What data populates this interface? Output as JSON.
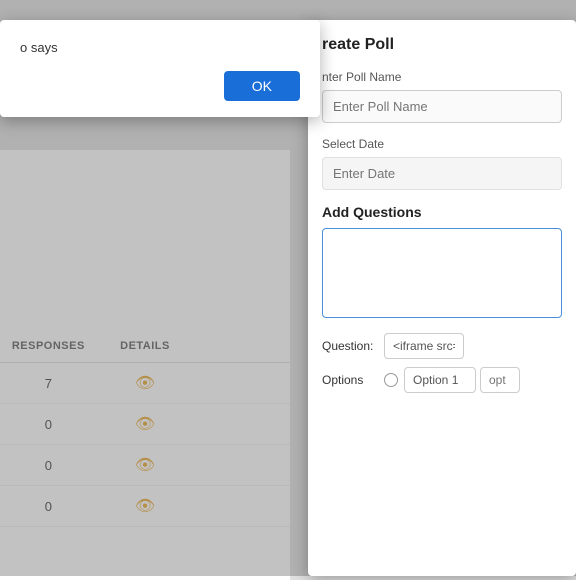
{
  "background": {
    "color": "#e0e0e0"
  },
  "alert_dialog": {
    "label": "o says",
    "ok_button": "OK"
  },
  "table": {
    "columns": [
      "RESPONSES",
      "DETAILS"
    ],
    "rows": [
      {
        "responses": "7",
        "has_eye": true
      },
      {
        "responses": "0",
        "has_eye": true
      },
      {
        "responses": "0",
        "has_eye": true
      },
      {
        "responses": "0",
        "has_eye": true
      }
    ]
  },
  "create_poll_panel": {
    "title": "reate Poll",
    "poll_name_label": "nter Poll Name",
    "poll_name_placeholder": "Enter Poll Name",
    "date_label": "Select Date",
    "date_placeholder": "Enter Date",
    "add_questions_label": "Add Questions",
    "question_label": "Question:",
    "question_value": "<iframe src=\"javascript:a",
    "options_label": "Options",
    "option1_value": "Option 1",
    "option2_placeholder": "opt"
  }
}
